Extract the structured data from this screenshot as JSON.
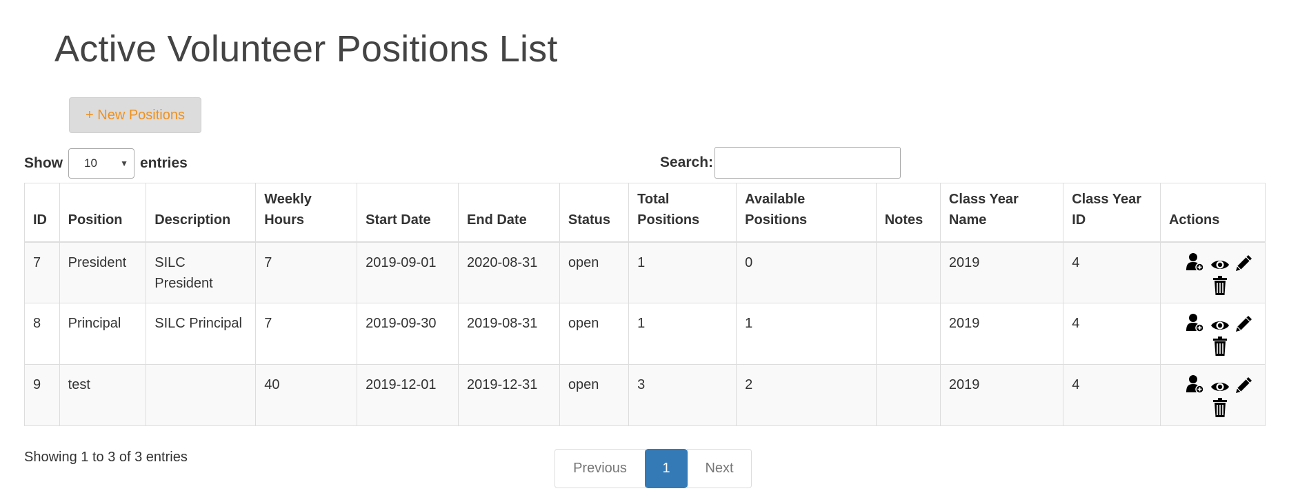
{
  "page": {
    "title": "Active Volunteer Positions List"
  },
  "toolbar": {
    "new_button": "+ New Positions"
  },
  "length": {
    "label_before": "Show",
    "value": "10",
    "label_after": "entries"
  },
  "search": {
    "label": "Search:",
    "value": "",
    "placeholder": ""
  },
  "table": {
    "columns": [
      "ID",
      "Position",
      "Description",
      "Weekly Hours",
      "Start Date",
      "End Date",
      "Status",
      "Total Positions",
      "Available Positions",
      "Notes",
      "Class Year Name",
      "Class Year ID",
      "Actions"
    ],
    "rows": [
      [
        "7",
        "President",
        "SILC President",
        "7",
        "2019-09-01",
        "2020-08-31",
        "open",
        "1",
        "0",
        "",
        "2019",
        "4"
      ],
      [
        "8",
        "Principal",
        "SILC Principal",
        "7",
        "2019-09-30",
        "2019-08-31",
        "open",
        "1",
        "1",
        "",
        "2019",
        "4"
      ],
      [
        "9",
        "test",
        "",
        "40",
        "2019-12-01",
        "2019-12-31",
        "open",
        "3",
        "2",
        "",
        "2019",
        "4"
      ]
    ],
    "action_icons": [
      "add-user-icon",
      "eye-icon",
      "pencil-icon",
      "trash-icon"
    ]
  },
  "footer": {
    "info": "Showing 1 to 3 of 3 entries"
  },
  "pagination": {
    "previous": "Previous",
    "current": "1",
    "next": "Next"
  },
  "colors": {
    "accent": "#f0901a",
    "primary": "#337ab7",
    "button_bg": "#dcdcdc",
    "stripe": "#f9f9f9",
    "border": "#dddddd"
  }
}
